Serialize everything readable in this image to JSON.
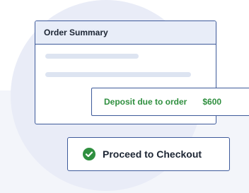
{
  "order_summary": {
    "title": "Order Summary"
  },
  "deposit": {
    "label": "Deposit due to order",
    "amount": "$600"
  },
  "checkout": {
    "label": "Proceed to Checkout",
    "icon": "check-circle-icon"
  },
  "colors": {
    "accent": "#3e5a9a",
    "success": "#2f8f3f",
    "circle_bg": "#e9ecf7",
    "header_bg": "#e8edf8"
  }
}
